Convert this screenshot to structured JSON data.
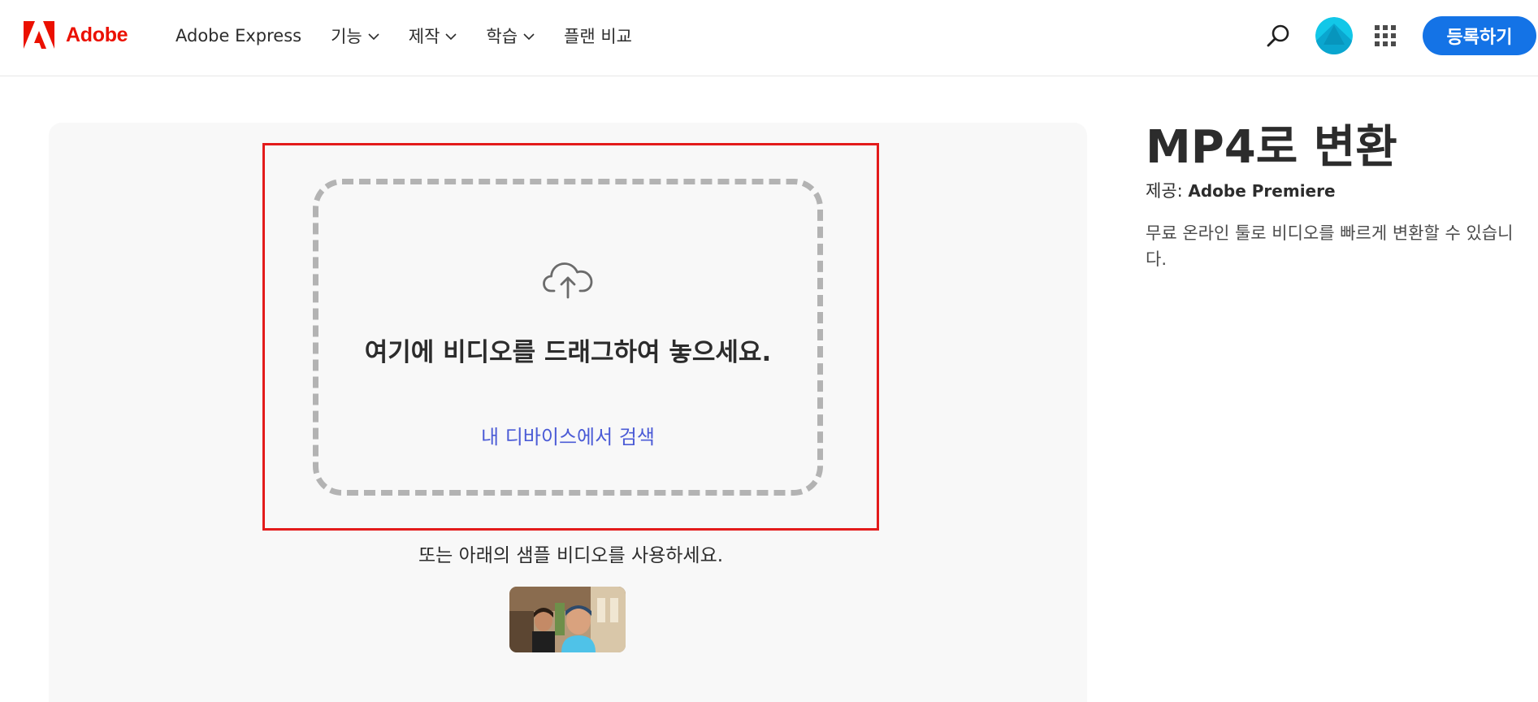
{
  "header": {
    "brand": "Adobe",
    "nav": [
      {
        "label": "Adobe Express",
        "has_dropdown": false
      },
      {
        "label": "기능",
        "has_dropdown": true
      },
      {
        "label": "제작",
        "has_dropdown": true
      },
      {
        "label": "학습",
        "has_dropdown": true
      },
      {
        "label": "플랜 비교",
        "has_dropdown": false
      }
    ],
    "signup_label": "등록하기",
    "icons": [
      "adobe-logo-icon",
      "search-icon",
      "avatar",
      "app-grid-icon",
      "chevron-down-icon"
    ]
  },
  "upload": {
    "drop_title": "여기에 비디오를 드래그하여 놓으세요.",
    "browse_label": "내 디바이스에서 검색",
    "sample_text": "또는 아래의 샘플 비디오를 사용하세요.",
    "icon": "cloud-upload-icon"
  },
  "info": {
    "title": "MP4로 변환",
    "provider_prefix": "제공: ",
    "provider_name": "Adobe Premiere",
    "description": "무료 온라인 툴로 비디오를 빠르게 변환할 수 있습니다."
  },
  "colors": {
    "brand_red": "#eb1000",
    "primary_blue": "#1473e6",
    "link_blue": "#4b5bd6",
    "highlight_red": "#e31b1b",
    "panel_bg": "#f8f8f8",
    "dash_gray": "#b3b3b3"
  }
}
